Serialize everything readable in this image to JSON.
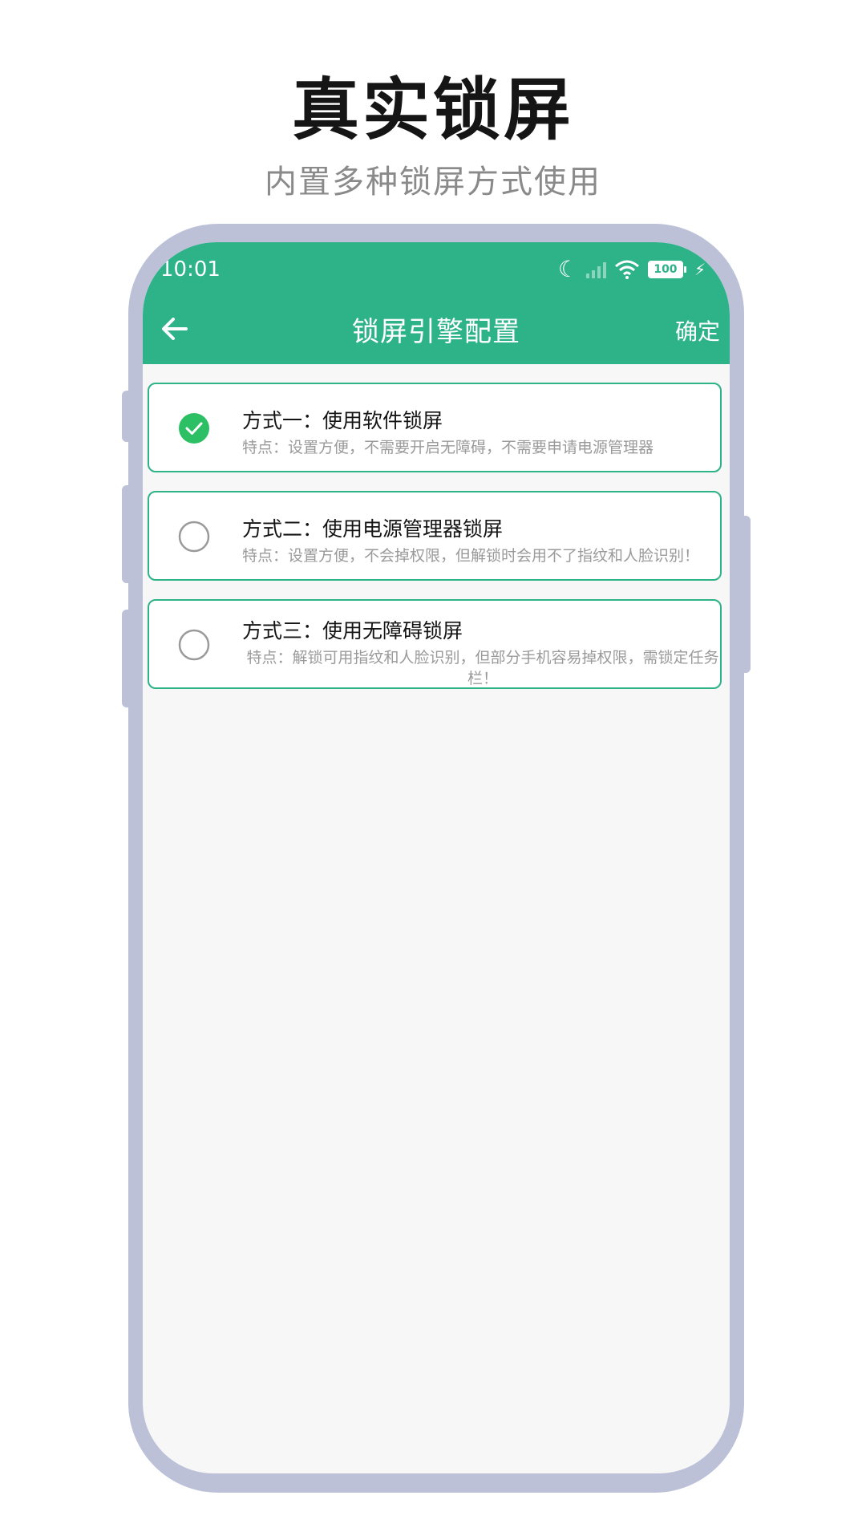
{
  "promo": {
    "title": "真实锁屏",
    "subtitle": "内置多种锁屏方式使用"
  },
  "status_bar": {
    "time": "10:01",
    "battery": "100",
    "icons": [
      "moon-icon",
      "signal-icon",
      "wifi-icon",
      "battery-icon",
      "charging-icon"
    ]
  },
  "app_bar": {
    "title": "锁屏引擎配置",
    "confirm_label": "确定",
    "back_icon": "arrow-left-icon",
    "color": "#2eb288"
  },
  "options": [
    {
      "title": "方式一：使用软件锁屏",
      "description": "特点：设置方便，不需要开启无障碍，不需要申请电源管理器",
      "selected": true
    },
    {
      "title": "方式二：使用电源管理器锁屏",
      "description": "特点：设置方便，不会掉权限，但解锁时会用不了指纹和人脸识别！",
      "selected": false
    },
    {
      "title": "方式三：使用无障碍锁屏",
      "description": "特点：解锁可用指纹和人脸识别，但部分手机容易掉权限，需锁定任务栏！",
      "selected": false
    }
  ],
  "colors": {
    "accent": "#2eb288",
    "check": "#2dbf64",
    "frame": "#bcc1d8"
  }
}
